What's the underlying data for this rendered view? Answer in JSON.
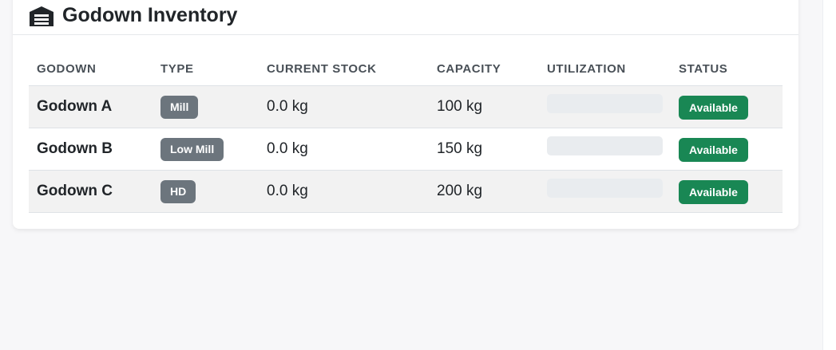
{
  "card": {
    "title": "Godown Inventory",
    "icon": "warehouse-icon"
  },
  "table": {
    "columns": [
      "GODOWN",
      "TYPE",
      "CURRENT STOCK",
      "CAPACITY",
      "UTILIZATION",
      "STATUS"
    ],
    "rows": [
      {
        "godown": "Godown A",
        "type": "Mill",
        "current_stock": "0.0 kg",
        "capacity": "100 kg",
        "utilization": 0,
        "status": "Available"
      },
      {
        "godown": "Godown B",
        "type": "Low Mill",
        "current_stock": "0.0 kg",
        "capacity": "150 kg",
        "utilization": 0,
        "status": "Available"
      },
      {
        "godown": "Godown C",
        "type": "HD",
        "current_stock": "0.0 kg",
        "capacity": "200 kg",
        "utilization": 0,
        "status": "Available"
      }
    ]
  },
  "colors": {
    "status_available": "#198754",
    "type_badge": "#6c757d",
    "utilization_track": "#e9ecef"
  }
}
